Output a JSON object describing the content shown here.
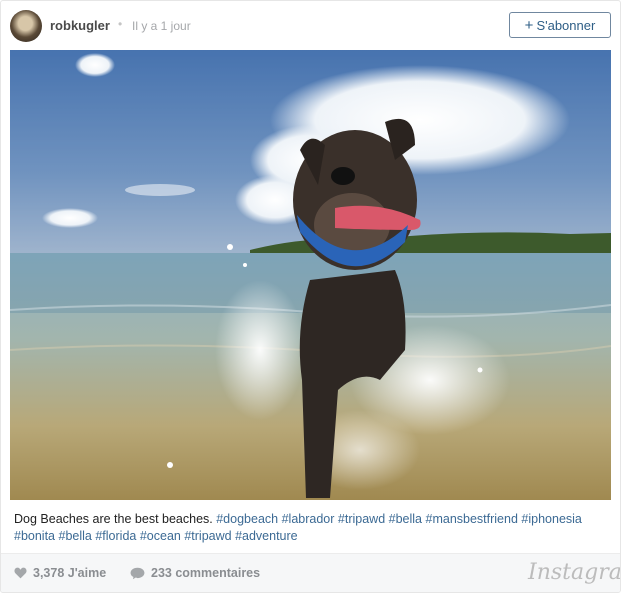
{
  "header": {
    "username": "robkugler",
    "separator": "•",
    "time_ago": "Il y a 1 jour",
    "follow_label": "S'abonner",
    "follow_icon": "plus-icon"
  },
  "photo": {
    "description_icon": "photo"
  },
  "caption": {
    "text": "Dog Beaches are the best beaches.",
    "hashtags": [
      "#dogbeach",
      "#labrador",
      "#tripawd",
      "#bella",
      "#mansbestfriend",
      "#iphonesia",
      "#bonita",
      "#bella",
      "#florida",
      "#ocean",
      "#tripawd",
      "#adventure"
    ]
  },
  "footer": {
    "likes": "3,378 J'aime",
    "comments": "233 commentaires",
    "brand": "Instagram",
    "like_icon": "heart-icon",
    "comment_icon": "comment-bubble-icon"
  },
  "colors": {
    "link": "#3c6a94",
    "follow_border": "#70879f",
    "muted": "#8a8d91"
  }
}
